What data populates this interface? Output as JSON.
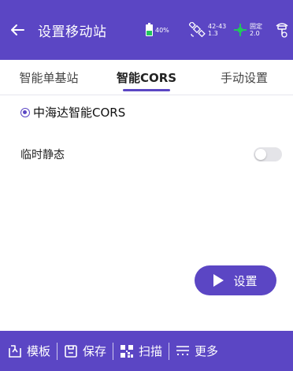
{
  "header": {
    "title": "设置移动站",
    "back_icon": "arrow-left-icon",
    "battery": {
      "text": "40%",
      "level": 0.4,
      "fill_color": "#22c55e"
    },
    "satellites": {
      "top": "42-43",
      "bottom": "1.3",
      "icon": "satellite-icon"
    },
    "fix": {
      "top": "固定",
      "bottom": "2.0",
      "icon": "crosshair-icon",
      "color": "#22c55e"
    },
    "rtk_icon": "receiver-icon"
  },
  "tabs": [
    {
      "label": "智能单基站",
      "active": false
    },
    {
      "label": "智能CORS",
      "active": true
    },
    {
      "label": "手动设置",
      "active": false
    }
  ],
  "content": {
    "radio_label": "中海达智能CORS",
    "radio_checked": true,
    "toggle_label": "临时静态",
    "toggle_on": false,
    "action_button": "设置"
  },
  "bottom_bar": {
    "items": [
      {
        "label": "模板",
        "icon": "template-icon"
      },
      {
        "label": "保存",
        "icon": "save-icon"
      },
      {
        "label": "扫描",
        "icon": "qr-scan-icon"
      },
      {
        "label": "更多",
        "icon": "more-menu-icon"
      }
    ]
  },
  "colors": {
    "primary": "#5b46c4",
    "accent_green": "#22c55e"
  }
}
